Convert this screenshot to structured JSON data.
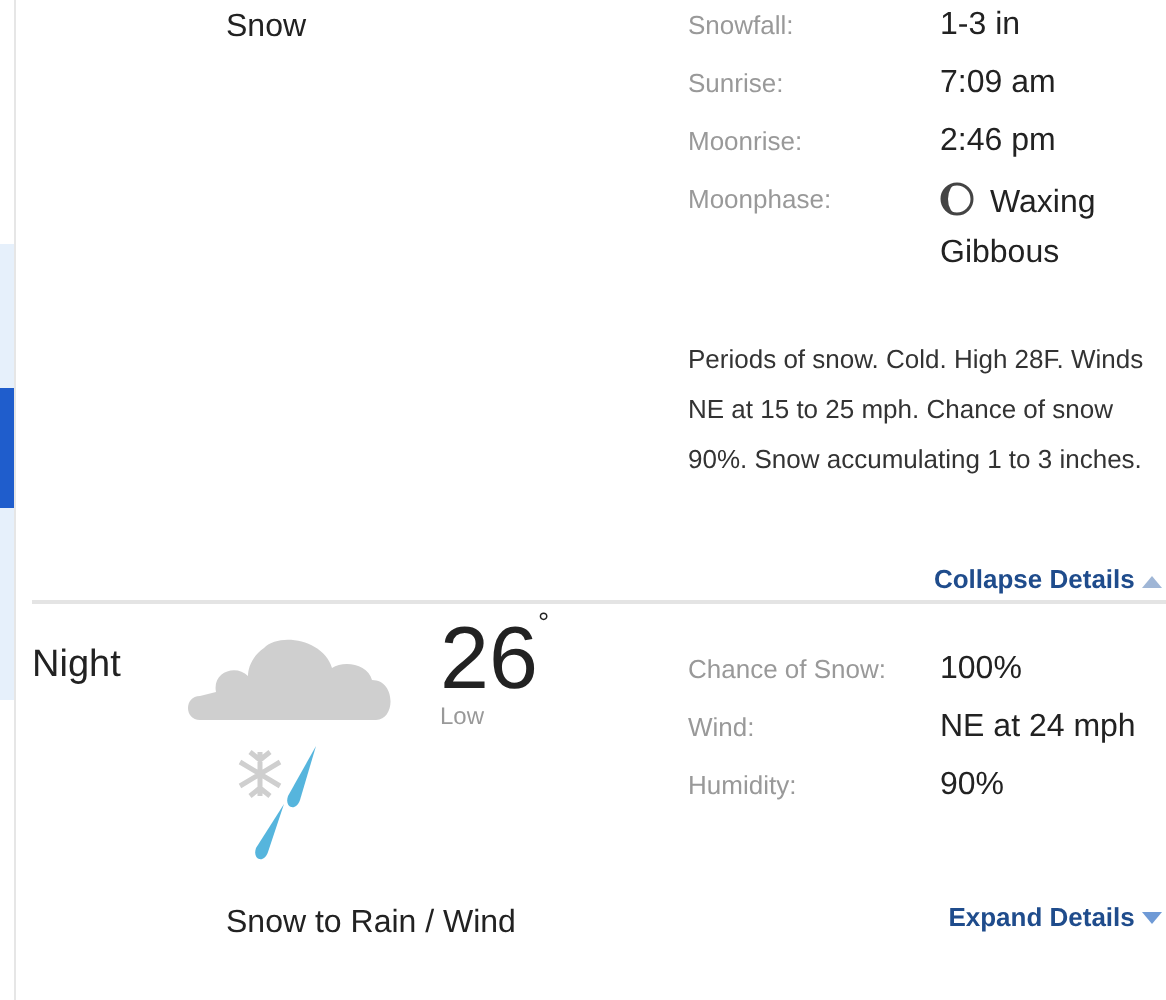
{
  "periods": [
    {
      "kind": "continued",
      "condition": "Snow",
      "details": [
        {
          "label": "Snowfall:",
          "value": "1-3 in"
        },
        {
          "label": "Sunrise:",
          "value": "7:09 am"
        },
        {
          "label": "Moonrise:",
          "value": "2:46 pm"
        },
        {
          "label": "Moonphase:",
          "value": "Waxing Gibbous",
          "kind": "moon"
        }
      ],
      "description": "Periods of snow. Cold. High 28F. Winds NE at 15 to 25 mph. Chance of snow 90%. Snow accumulating 1 to 3 inches.",
      "expanded": true,
      "toggle": "Collapse Details"
    },
    {
      "kind": "full",
      "name": "Night",
      "temperature": "26",
      "degree": "°",
      "temp_label": "Low",
      "condition": "Snow to Rain / Wind",
      "details": [
        {
          "label": "Chance of Snow:",
          "value": "100%"
        },
        {
          "label": "Wind:",
          "value": "NE at 24 mph"
        },
        {
          "label": "Humidity:",
          "value": "90%"
        }
      ],
      "expanded": false,
      "toggle": "Expand Details"
    }
  ]
}
